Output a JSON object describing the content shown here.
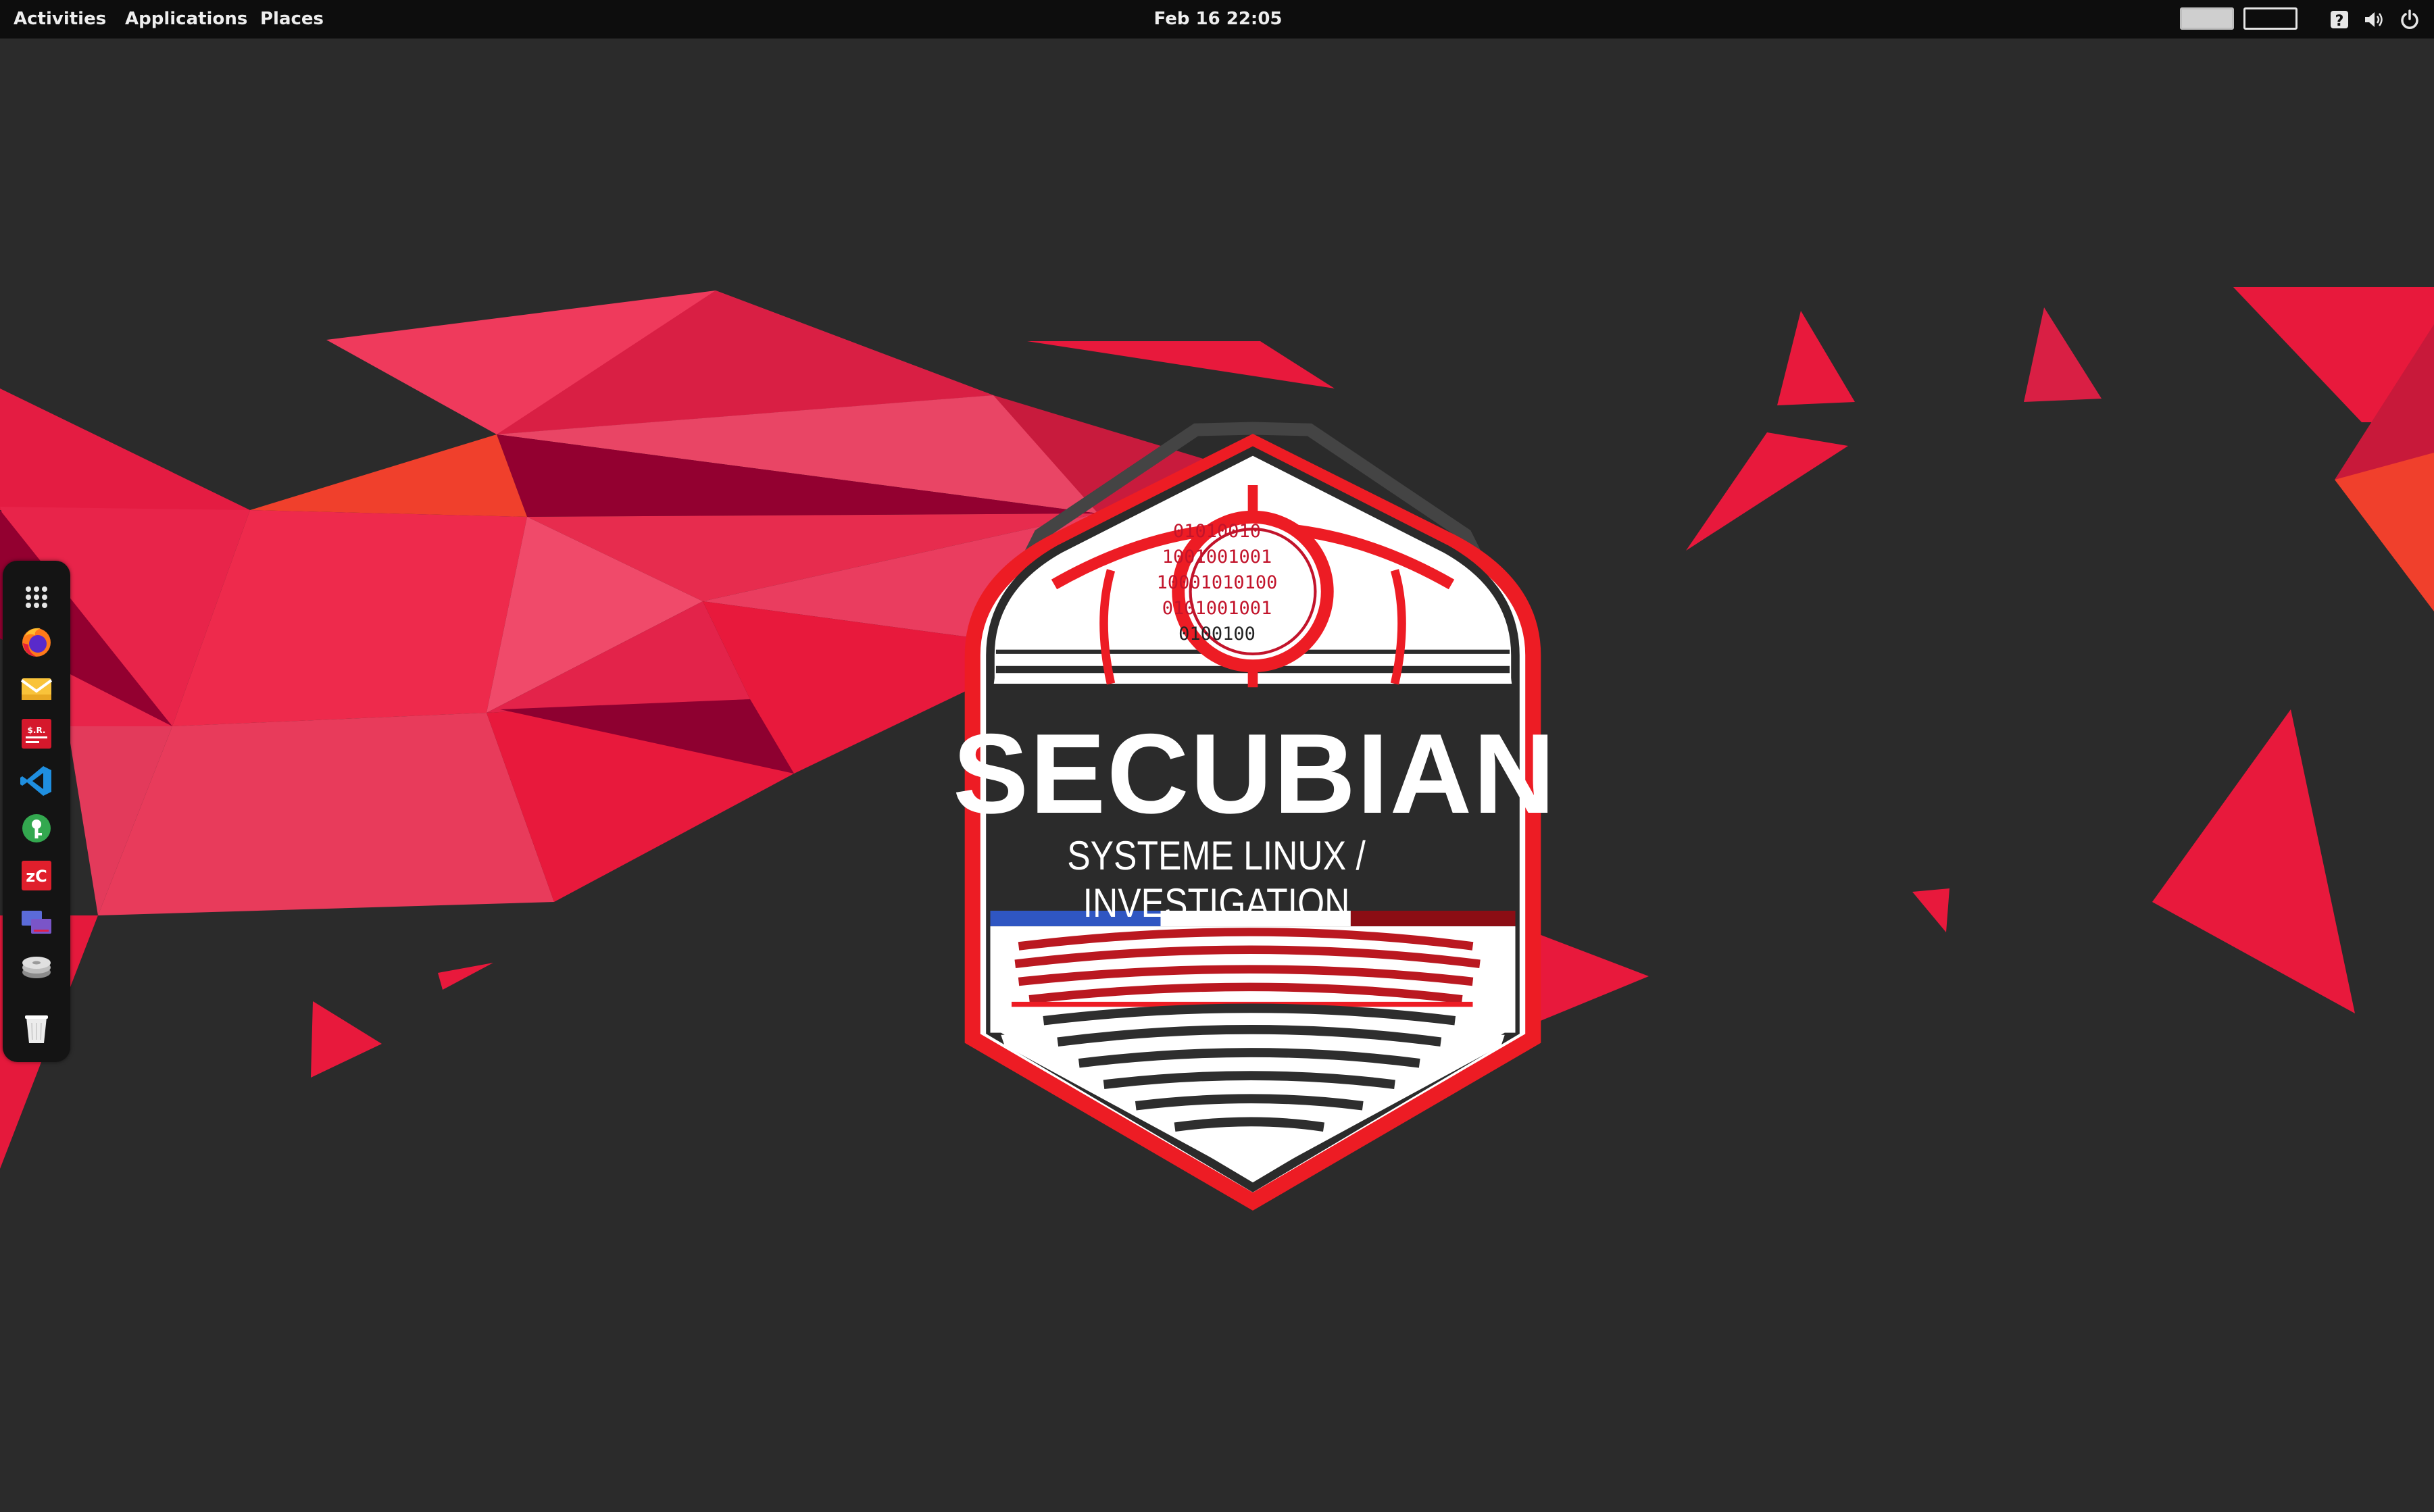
{
  "topbar": {
    "activities": "Activities",
    "applications": "Applications",
    "places": "Places",
    "clock": "Feb 16  22:05",
    "tray": [
      "keyboard-layout-indicator",
      "keyboard-layout-indicator",
      "help-icon",
      "volume-icon",
      "power-icon"
    ]
  },
  "dock": {
    "items": [
      "show-applications-icon",
      "firefox-icon",
      "mail-icon",
      "forensic-app-icon",
      "vscode-icon",
      "keepass-icon",
      "zcash-icon",
      "screen-icon",
      "disks-icon",
      "trash-icon"
    ]
  },
  "logo": {
    "title": "SECUBIAN",
    "subtitle": "SYSTEME LINUX / INVESTIGATION",
    "binary_lines": [
      "01010010",
      "1001001001",
      "10001010100",
      "0101001001",
      "0100100"
    ]
  },
  "colors": {
    "background": "#2b2b2b",
    "topbar": "#0d0d0d",
    "accent_red": "#e8193c",
    "dark_red": "#8e0030"
  }
}
